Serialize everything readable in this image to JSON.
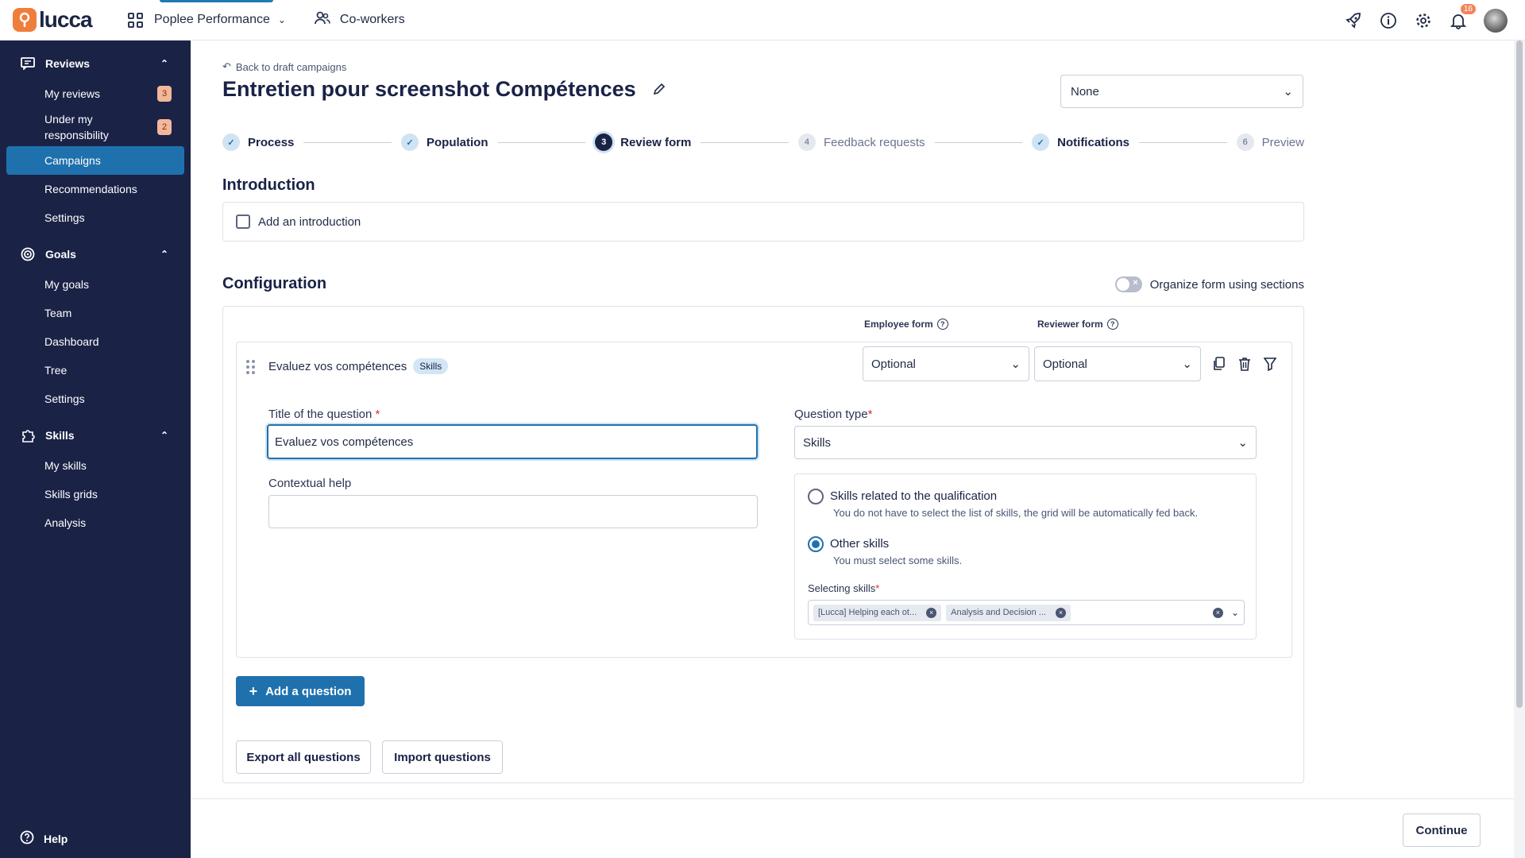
{
  "topbar": {
    "logo_text": "lucca",
    "app_name": "Poplee Performance",
    "coworkers": "Co-workers",
    "notifications_count": "16"
  },
  "sidebar": {
    "groups": [
      {
        "label": "Reviews",
        "items": [
          {
            "label": "My reviews",
            "badge": "3"
          },
          {
            "label": "Under my responsibility",
            "badge": "2"
          },
          {
            "label": "Campaigns"
          },
          {
            "label": "Recommendations"
          },
          {
            "label": "Settings"
          }
        ]
      },
      {
        "label": "Goals",
        "items": [
          {
            "label": "My goals"
          },
          {
            "label": "Team"
          },
          {
            "label": "Dashboard"
          },
          {
            "label": "Tree"
          },
          {
            "label": "Settings"
          }
        ]
      },
      {
        "label": "Skills",
        "items": [
          {
            "label": "My skills"
          },
          {
            "label": "Skills grids"
          },
          {
            "label": "Analysis"
          }
        ]
      }
    ],
    "help": "Help"
  },
  "page": {
    "back": "Back to draft campaigns",
    "title": "Entretien pour screenshot Compétences",
    "select_value": "None"
  },
  "steps": [
    {
      "label": "Process",
      "num": "✓"
    },
    {
      "label": "Population",
      "num": "✓"
    },
    {
      "label": "Review form",
      "num": "3"
    },
    {
      "label": "Feedback requests",
      "num": "4"
    },
    {
      "label": "Notifications",
      "num": "✓"
    },
    {
      "label": "Preview",
      "num": "6"
    }
  ],
  "introduction": {
    "heading": "Introduction",
    "checkbox_label": "Add an introduction"
  },
  "configuration": {
    "heading": "Configuration",
    "toggle_label": "Organize form using sections",
    "employee_form": "Employee form",
    "reviewer_form": "Reviewer form",
    "question": {
      "name": "Evaluez vos compétences",
      "tag": "Skills",
      "employee_value": "Optional",
      "reviewer_value": "Optional",
      "title_label": "Title of the question",
      "title_value": "Evaluez vos compétences",
      "help_label": "Contextual help",
      "help_value": "",
      "type_label": "Question type",
      "type_value": "Skills",
      "option1_title": "Skills related to the qualification",
      "option1_sub": "You do not have to select the list of skills, the grid will be automatically fed back.",
      "option2_title": "Other skills",
      "option2_sub": "You must select some skills.",
      "selecting_label": "Selecting skills",
      "chips": [
        "[Lucca] Helping each ot...",
        "Analysis and Decision ..."
      ]
    },
    "add_question": "Add a question",
    "export": "Export all questions",
    "import": "Import questions"
  },
  "footer": {
    "continue": "Continue"
  }
}
